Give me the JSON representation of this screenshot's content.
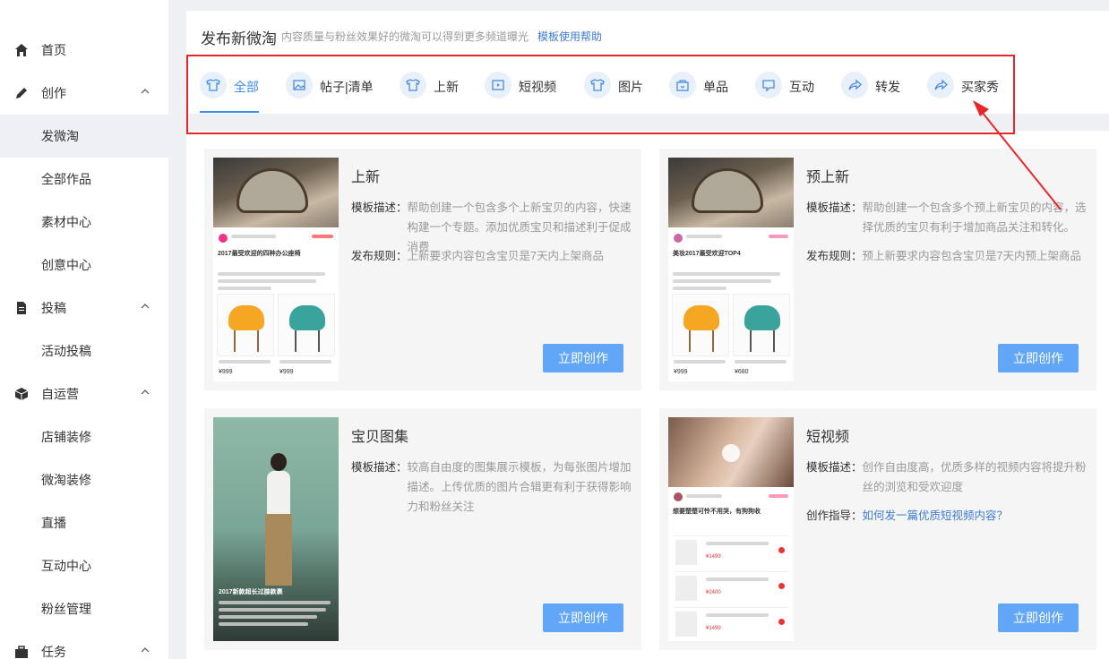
{
  "sidebar": {
    "home": "首页",
    "create": "创作",
    "create_items": [
      "发微淘",
      "全部作品",
      "素材中心",
      "创意中心"
    ],
    "submit": "投稿",
    "submit_items": [
      "活动投稿"
    ],
    "self_op": "自运营",
    "self_op_items": [
      "店铺装修",
      "微淘装修",
      "直播",
      "互动中心",
      "粉丝管理"
    ],
    "task": "任务",
    "active_item": "发微淘"
  },
  "header": {
    "title": "发布新微淘",
    "subtitle": "内容质量与粉丝效果好的微淘可以得到更多频道曝光",
    "help_link": "模板使用帮助"
  },
  "tabs": [
    {
      "label": "全部",
      "icon": "shirt-icon",
      "active": true
    },
    {
      "label": "帖子|清单",
      "icon": "image-icon"
    },
    {
      "label": "上新",
      "icon": "shirt-icon"
    },
    {
      "label": "短视频",
      "icon": "film-icon"
    },
    {
      "label": "图片",
      "icon": "shirt-icon"
    },
    {
      "label": "单品",
      "icon": "bag-icon"
    },
    {
      "label": "互动",
      "icon": "chat-icon"
    },
    {
      "label": "转发",
      "icon": "share-icon"
    },
    {
      "label": "买家秀",
      "icon": "share-icon"
    }
  ],
  "cards": [
    {
      "title": "上新",
      "desc_label": "模板描述：",
      "desc": "帮助创建一个包含多个上新宝贝的内容，快速构建一个专题。添加优质宝贝和描述利于促成消费",
      "rule_label": "发布规则：",
      "rule": "上新要求内容包含宝贝是7天内上架商品",
      "button": "立即创作",
      "thumb_title": "2017最受欢迎的四种办公座椅",
      "price_a": "¥999",
      "price_b": "¥999"
    },
    {
      "title": "预上新",
      "desc_label": "模板描述：",
      "desc": "帮助创建一个包含多个预上新宝贝的内容，选择优质的宝贝有利于增加商品关注和转化。",
      "rule_label": "发布规则：",
      "rule": "预上新要求内容包含宝贝是7天内预上架商品",
      "button": "立即创作",
      "thumb_title": "美妆2017最受欢迎TOP4",
      "price_a": "¥999",
      "price_b": "¥680"
    },
    {
      "title": "宝贝图集",
      "desc_label": "模板描述：",
      "desc": "较高自由度的图集展示模板，为每张图片增加描述。上传优质的图片合辑更有利于获得影响力和粉丝关注",
      "button": "立即创作",
      "thumb_title": "2017新款超长过膝款裹"
    },
    {
      "title": "短视频",
      "desc_label": "模板描述：",
      "desc": "创作自由度高，优质多样的视频内容将提升粉丝的浏览和受欢迎度",
      "guide_label": "创作指导：",
      "guide_link": "如何发一篇优质短视频内容？",
      "button": "立即创作",
      "thumb_title": "想要楚楚可怜不用哭，有狗狗收",
      "prices": [
        "¥1499",
        "¥2400",
        "¥1499"
      ]
    }
  ],
  "colors": {
    "accent": "#3d8ff0",
    "button": "#62a6f7",
    "annotation": "#e8262a"
  }
}
